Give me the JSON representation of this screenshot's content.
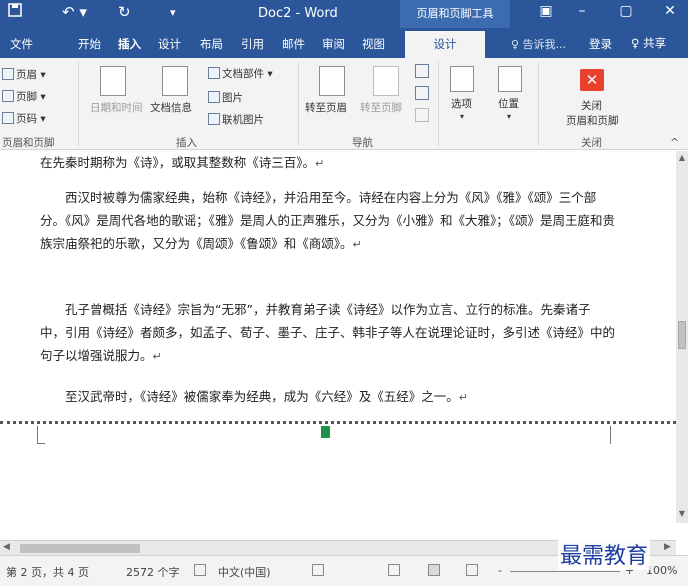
{
  "titlebar": {
    "save_icon": "save-icon",
    "undo_glyph": "↶ ▾",
    "redo_glyph": "↻",
    "customize_glyph": "▾",
    "title": "Doc2 - Word",
    "context_tab": "页眉和页脚工具",
    "ribbon_display_glyph": "▣",
    "minimize_glyph": "–",
    "maximize_glyph": "▢",
    "close_glyph": "✕"
  },
  "tabs": {
    "file": "文件",
    "home": "开始",
    "insert": "插入",
    "design": "设计",
    "layout": "布局",
    "references": "引用",
    "mailings": "邮件",
    "review": "审阅",
    "view": "视图",
    "active_design": "设计",
    "tell_me": "♀ 告诉我...",
    "signin": "登录",
    "share": "♀ 共享"
  },
  "ribbon": {
    "header_btn": "页眉 ▾",
    "footer_btn": "页脚 ▾",
    "page_number_btn": "页码 ▾",
    "group_header_footer": "页眉和页脚",
    "date_time_btn": "日期和时间",
    "doc_info_btn": "文档信息",
    "quick_parts_btn": "文档部件 ▾",
    "picture_btn": "图片",
    "online_picture_btn": "联机图片",
    "group_insert": "插入",
    "goto_header_btn": "转至页眉",
    "goto_footer_btn": "转至页脚",
    "group_navigation": "导航",
    "options_btn": "选项",
    "options_caret": "▾",
    "position_btn": "位置",
    "position_caret": "▾",
    "close_btn_line1": "关闭",
    "close_btn_line2": "页眉和页脚",
    "close_glyph": "✕",
    "group_close": "关闭",
    "collapse_glyph": "^"
  },
  "document": {
    "line1": "在先秦时期称为《诗》，或取其整数称《诗三百》。",
    "para2": "西汉时被尊为儒家经典，始称《诗经》，并沿用至今。诗经在内容上分为《风》《雅》《颂》三个部分。《风》是周代各地的歌谣；《雅》是周人的正声雅乐，又分为《小雅》和《大雅》；《颂》是周王庭和贵族宗庙祭祀的乐歌，又分为《周颂》《鲁颂》和《商颂》。",
    "para3": "孔子曾概括《诗经》宗旨为“无邪”，并教育弟子读《诗经》以作为立言、立行的标准。先秦诸子中，引用《诗经》者颇多，如孟子、荀子、墨子、庄子、韩非子等人在说理论证时，多引述《诗经》中的句子以增强说服力。",
    "para4": "至汉武帝时，《诗经》被儒家奉为经典，成为《六经》及《五经》之一。",
    "paragraph_mark": "↵"
  },
  "statusbar": {
    "page": "第 2 页，共 4 页",
    "words": "2572 个字",
    "language": "中文(中国)",
    "zoom_minus": "-",
    "zoom_plus": "+",
    "zoom": "100%"
  },
  "scroll": {
    "up": "▲",
    "down": "▼",
    "left": "◀",
    "right": "▶"
  },
  "watermark": "最需教育"
}
